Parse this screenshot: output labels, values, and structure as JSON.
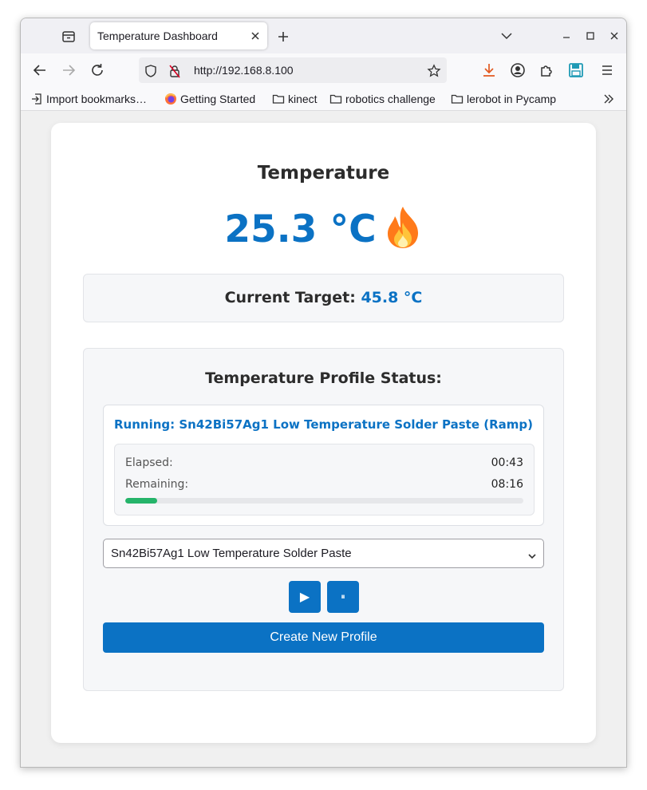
{
  "browser": {
    "tab_title": "Temperature Dashboard",
    "url": "http://192.168.8.100",
    "bookmarks": [
      "Import bookmarks…",
      "Getting Started",
      "kinect",
      "robotics challenge",
      "lerobot in Pycamp"
    ]
  },
  "dashboard": {
    "temperature_heading": "Temperature",
    "temperature_value": "25.3 °C",
    "temperature_icon": "flame-icon",
    "target_label": "Current Target:",
    "target_value": "45.8 °C",
    "profile_heading": "Temperature Profile Status:",
    "running_text": "Running: Sn42Bi57Ag1 Low Temperature Solder Paste (Ramp)",
    "elapsed_label": "Elapsed:",
    "elapsed_value": "00:43",
    "remaining_label": "Remaining:",
    "remaining_value": "08:16",
    "progress_percent": 8,
    "selected_profile": "Sn42Bi57Ag1 Low Temperature Solder Paste",
    "play_symbol": "▶",
    "pause_symbol": "⏸",
    "create_button": "Create New Profile"
  },
  "colors": {
    "accent": "#0b72c4",
    "progress": "#25b46a",
    "flame": "#ff7a1a"
  }
}
